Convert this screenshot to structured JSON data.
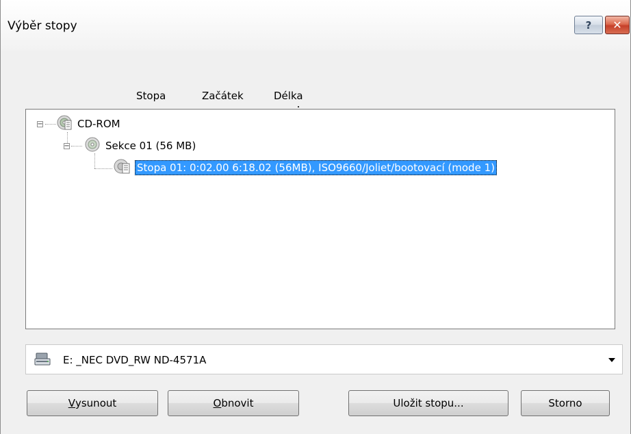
{
  "window": {
    "title": "Výběr stopy"
  },
  "title_buttons": {
    "help_glyph": "?",
    "close_glyph": "✕"
  },
  "columns": {
    "stopa": "Stopa",
    "zacatek": "Začátek",
    "delka": "Délka"
  },
  "tree": {
    "root": {
      "label": "CD-ROM",
      "icon": "cd-drive-icon",
      "expanded": true
    },
    "session": {
      "label": "Sekce 01 (56 MB)",
      "icon": "disc-icon",
      "expanded": true
    },
    "track": {
      "label": "Stopa 01: 0:02.00 6:18.02 (56MB), ISO9660/Joliet/bootovací (mode 1)",
      "icon": "data-track-icon",
      "selected": true
    }
  },
  "drive": {
    "selected": "E: _NEC DVD_RW ND-4571A",
    "icon": "optical-drive-icon"
  },
  "buttons": {
    "vysunout": {
      "mnemonic": "V",
      "rest": "ysunout"
    },
    "obnovit": {
      "mnemonic": "O",
      "rest": "bnovit"
    },
    "ulozit": {
      "label": "Uložit stopu..."
    },
    "storno": {
      "label": "Storno"
    }
  },
  "colors": {
    "selection": "#3399ff",
    "window_bg": "#f0f0f0"
  }
}
